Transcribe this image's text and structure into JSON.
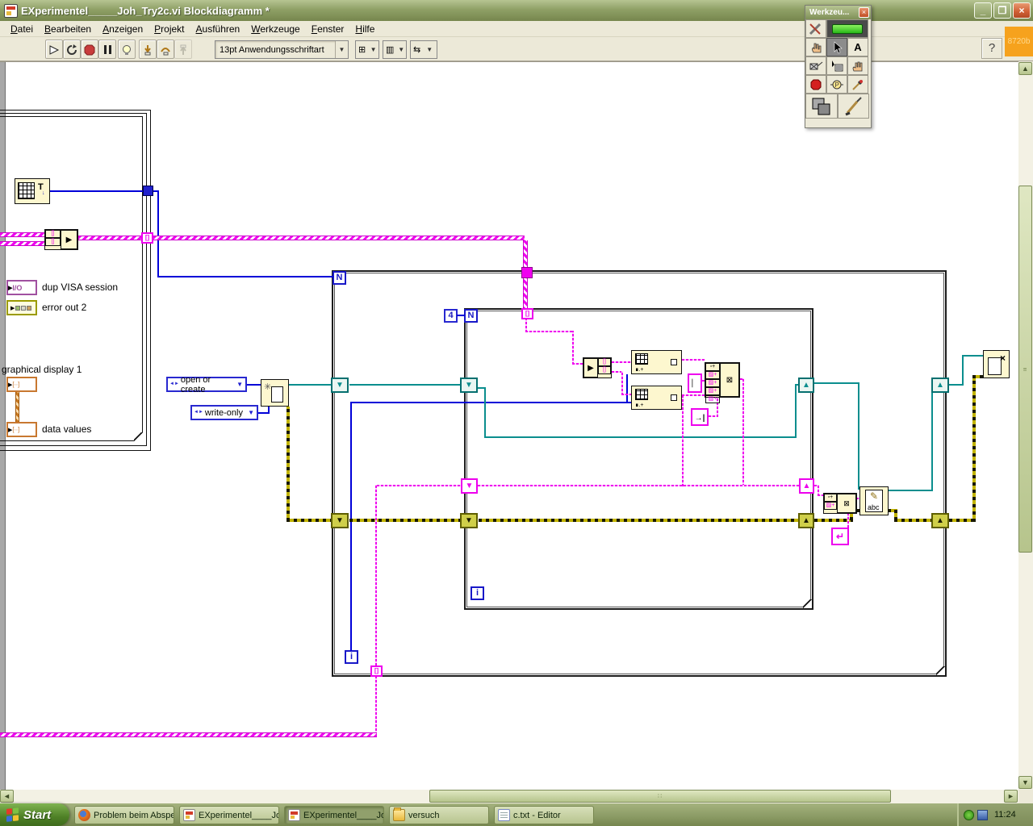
{
  "window": {
    "title": "EXperimentel_____Joh_Try2c.vi Blockdiagramm *",
    "badge": "8720b",
    "help": "?"
  },
  "menu": {
    "items": [
      "Datei",
      "Bearbeiten",
      "Anzeigen",
      "Projekt",
      "Ausführen",
      "Werkzeuge",
      "Fenster",
      "Hilfe"
    ]
  },
  "toolbar": {
    "font_selector": "13pt Anwendungsschriftart"
  },
  "palette": {
    "title": "Werkzeu...",
    "close": "×",
    "edit_text_tool": "A",
    "probe_tool": "P"
  },
  "diagram": {
    "labels": {
      "dup_visa": "dup VISA session",
      "error_out": "error out 2",
      "graphical_display": "graphical display 1",
      "data_values": "data values"
    },
    "constants": {
      "open_mode": "open or create",
      "access_mode": "write-only",
      "inner_count": "4"
    },
    "terms": {
      "visa": "I/O",
      "loop_count": "N",
      "loop_iter": "i",
      "array_glyph": "[∙∙]",
      "index_glyph": "[]"
    },
    "nodes": {
      "write_abc": "abc",
      "index_sub": "∎.+",
      "concat_out": "⊠",
      "tab_glyph": "→|",
      "eol_glyph": "↵",
      "table_glyph": "T"
    },
    "colors": {
      "string_pink": "#F000F0",
      "refnum_teal": "#0B8E8E",
      "error_olive": "#B0A800",
      "numeric_blue": "#0000D8",
      "visa_purple": "#A050A0",
      "array_orange": "#C87830"
    }
  },
  "taskbar": {
    "start": "Start",
    "buttons": [
      {
        "label": "Problem beim Abspeic...",
        "icon": "firefox"
      },
      {
        "label": "EXperimentel____Joh...",
        "icon": "labview"
      },
      {
        "label": "EXperimentel____Joh...",
        "icon": "labview"
      },
      {
        "label": "versuch",
        "icon": "folder"
      },
      {
        "label": "c.txt - Editor",
        "icon": "notepad"
      }
    ],
    "clock": "11:24"
  }
}
